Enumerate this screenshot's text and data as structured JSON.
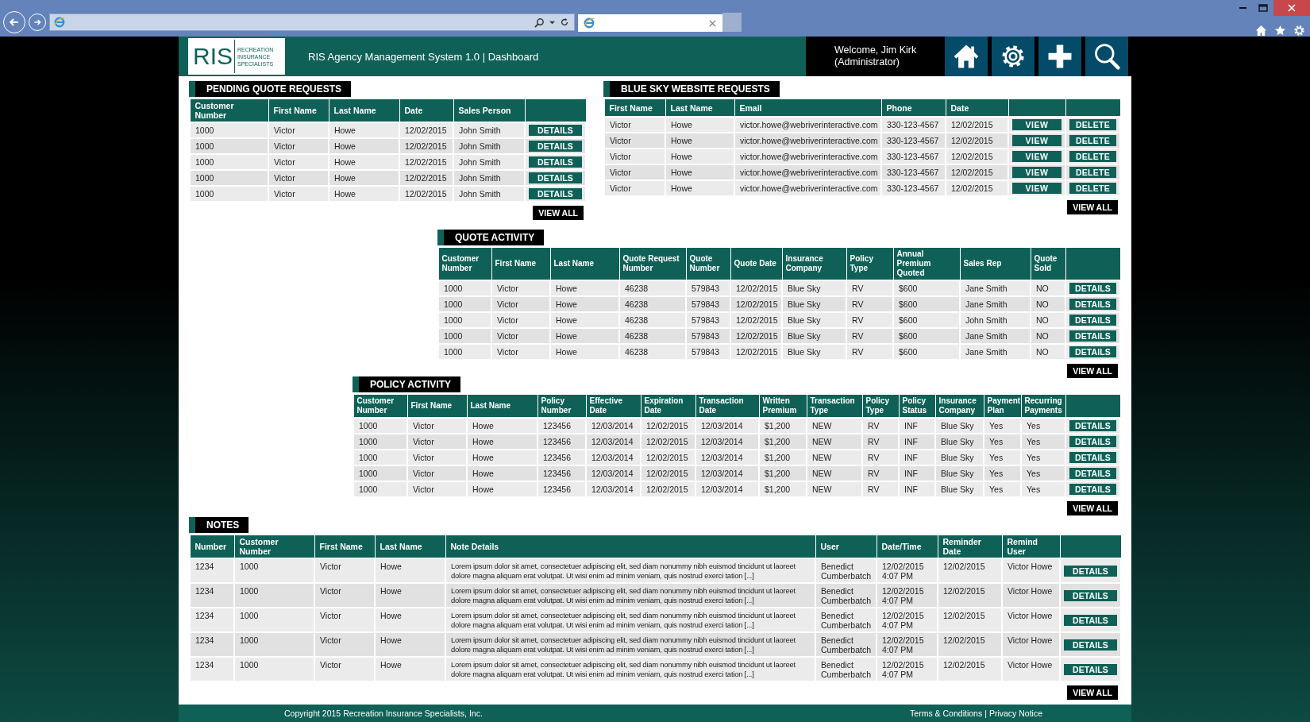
{
  "app": {
    "logo_letters": "RIS",
    "logo_tagline": "RECREATION INSURANCE SPECIALISTS",
    "title": "RIS Agency Management System 1.0 | Dashboard",
    "welcome": "Welcome, Jim Kirk",
    "role": "(Administrator)"
  },
  "sections": [
    {
      "title": "PENDING QUOTE REQUESTS",
      "columns": [
        "Customer Number",
        "First Name",
        "Last Name",
        "Date",
        "Sales Person"
      ],
      "rows": [
        {
          "cells": [
            "1000",
            "Victor",
            "Howe",
            "12/02/2015",
            "John Smith"
          ],
          "actions": [
            {
              "label": "DETAILS",
              "kind": "details"
            }
          ]
        },
        {
          "cells": [
            "1000",
            "Victor",
            "Howe",
            "12/02/2015",
            "John Smith"
          ],
          "actions": [
            {
              "label": "DETAILS",
              "kind": "details"
            }
          ]
        },
        {
          "cells": [
            "1000",
            "Victor",
            "Howe",
            "12/02/2015",
            "John Smith"
          ],
          "actions": [
            {
              "label": "DETAILS",
              "kind": "details"
            }
          ]
        },
        {
          "cells": [
            "1000",
            "Victor",
            "Howe",
            "12/02/2015",
            "John Smith"
          ],
          "actions": [
            {
              "label": "DETAILS",
              "kind": "details"
            }
          ]
        },
        {
          "cells": [
            "1000",
            "Victor",
            "Howe",
            "12/02/2015",
            "John Smith"
          ],
          "actions": [
            {
              "label": "DETAILS",
              "kind": "details"
            }
          ]
        }
      ],
      "view_all": "VIEW ALL"
    },
    {
      "title": "BLUE SKY WEBSITE REQUESTS",
      "columns": [
        "First Name",
        "Last Name",
        "Email",
        "Phone",
        "Date"
      ],
      "rows": [
        {
          "cells": [
            "Victor",
            "Howe",
            "victor.howe@webriverinteractive.com",
            "330-123-4567",
            "12/02/2015"
          ],
          "actions": [
            {
              "label": "VIEW",
              "kind": "view"
            },
            {
              "label": "DELETE",
              "kind": "delete"
            }
          ]
        },
        {
          "cells": [
            "Victor",
            "Howe",
            "victor.howe@webriverinteractive.com",
            "330-123-4567",
            "12/02/2015"
          ],
          "actions": [
            {
              "label": "VIEW",
              "kind": "view"
            },
            {
              "label": "DELETE",
              "kind": "delete"
            }
          ]
        },
        {
          "cells": [
            "Victor",
            "Howe",
            "victor.howe@webriverinteractive.com",
            "330-123-4567",
            "12/02/2015"
          ],
          "actions": [
            {
              "label": "VIEW",
              "kind": "view"
            },
            {
              "label": "DELETE",
              "kind": "delete"
            }
          ]
        },
        {
          "cells": [
            "Victor",
            "Howe",
            "victor.howe@webriverinteractive.com",
            "330-123-4567",
            "12/02/2015"
          ],
          "actions": [
            {
              "label": "VIEW",
              "kind": "view"
            },
            {
              "label": "DELETE",
              "kind": "delete"
            }
          ]
        },
        {
          "cells": [
            "Victor",
            "Howe",
            "victor.howe@webriverinteractive.com",
            "330-123-4567",
            "12/02/2015"
          ],
          "actions": [
            {
              "label": "VIEW",
              "kind": "view"
            },
            {
              "label": "DELETE",
              "kind": "delete"
            }
          ]
        }
      ],
      "view_all": "VIEW ALL"
    },
    {
      "title": "QUOTE ACTIVITY",
      "columns": [
        "Customer Number",
        "First Name",
        "Last Name",
        "Quote Request Number",
        "Quote Number",
        "Quote Date",
        "Insurance Company",
        "Policy Type",
        "Annual Premium Quoted",
        "Sales Rep",
        "Quote Sold"
      ],
      "rows": [
        {
          "cells": [
            "1000",
            "Victor",
            "Howe",
            "46238",
            "579843",
            "12/02/2015",
            "Blue Sky",
            "RV",
            "$600",
            "Jane Smith",
            "NO"
          ],
          "actions": [
            {
              "label": "DETAILS",
              "kind": "details"
            }
          ]
        },
        {
          "cells": [
            "1000",
            "Victor",
            "Howe",
            "46238",
            "579843",
            "12/02/2015",
            "Blue Sky",
            "RV",
            "$600",
            "Jane Smith",
            "NO"
          ],
          "actions": [
            {
              "label": "DETAILS",
              "kind": "details"
            }
          ]
        },
        {
          "cells": [
            "1000",
            "Victor",
            "Howe",
            "46238",
            "579843",
            "12/02/2015",
            "Blue Sky",
            "RV",
            "$600",
            "John Smith",
            "NO"
          ],
          "actions": [
            {
              "label": "DETAILS",
              "kind": "details"
            }
          ]
        },
        {
          "cells": [
            "1000",
            "Victor",
            "Howe",
            "46238",
            "579843",
            "12/02/2015",
            "Blue Sky",
            "RV",
            "$600",
            "Jane Smith",
            "NO"
          ],
          "actions": [
            {
              "label": "DETAILS",
              "kind": "details"
            }
          ]
        },
        {
          "cells": [
            "1000",
            "Victor",
            "Howe",
            "46238",
            "579843",
            "12/02/2015",
            "Blue Sky",
            "RV",
            "$600",
            "Jane Smith",
            "NO"
          ],
          "actions": [
            {
              "label": "DETAILS",
              "kind": "details"
            }
          ]
        }
      ],
      "view_all": "VIEW ALL"
    },
    {
      "title": "POLICY ACTIVITY",
      "columns": [
        "Customer Number",
        "First Name",
        "Last Name",
        "Policy Number",
        "Effective Date",
        "Expiration Date",
        "Transaction Date",
        "Written Premium",
        "Transaction Type",
        "Policy Type",
        "Policy Status",
        "Insurance Company",
        "Payment Plan",
        "Recurring Payments"
      ],
      "rows": [
        {
          "cells": [
            "1000",
            "Victor",
            "Howe",
            "123456",
            "12/03/2014",
            "12/02/2015",
            "12/03/2014",
            "$1,200",
            "NEW",
            "RV",
            "INF",
            "Blue Sky",
            "Yes",
            "Yes"
          ],
          "actions": [
            {
              "label": "DETAILS",
              "kind": "details"
            }
          ]
        },
        {
          "cells": [
            "1000",
            "Victor",
            "Howe",
            "123456",
            "12/03/2014",
            "12/02/2015",
            "12/03/2014",
            "$1,200",
            "NEW",
            "RV",
            "INF",
            "Blue Sky",
            "Yes",
            "Yes"
          ],
          "actions": [
            {
              "label": "DETAILS",
              "kind": "details"
            }
          ]
        },
        {
          "cells": [
            "1000",
            "Victor",
            "Howe",
            "123456",
            "12/03/2014",
            "12/02/2015",
            "12/03/2014",
            "$1,200",
            "NEW",
            "RV",
            "INF",
            "Blue Sky",
            "Yes",
            "Yes"
          ],
          "actions": [
            {
              "label": "DETAILS",
              "kind": "details"
            }
          ]
        },
        {
          "cells": [
            "1000",
            "Victor",
            "Howe",
            "123456",
            "12/03/2014",
            "12/02/2015",
            "12/03/2014",
            "$1,200",
            "NEW",
            "RV",
            "INF",
            "Blue Sky",
            "Yes",
            "Yes"
          ],
          "actions": [
            {
              "label": "DETAILS",
              "kind": "details"
            }
          ]
        },
        {
          "cells": [
            "1000",
            "Victor",
            "Howe",
            "123456",
            "12/03/2014",
            "12/02/2015",
            "12/03/2014",
            "$1,200",
            "NEW",
            "RV",
            "INF",
            "Blue Sky",
            "Yes",
            "Yes"
          ],
          "actions": [
            {
              "label": "DETAILS",
              "kind": "details"
            }
          ]
        }
      ],
      "view_all": "VIEW ALL"
    },
    {
      "title": "NOTES",
      "columns": [
        "Number",
        "Customer Number",
        "First Name",
        "Last Name",
        "Note Details",
        "User",
        "Date/Time",
        "Reminder Date",
        "Remind User"
      ],
      "rows": [
        {
          "cells": [
            "1234",
            "1000",
            "Victor",
            "Howe",
            "Lorem ipsum dolor sit amet, consectetuer adipiscing elit, sed diam nonummy nibh euismod tincidunt ut laoreet dolore magna aliquam erat volutpat. Ut wisi enim ad minim veniam, quis nostrud exerci tation [...]",
            "Benedict Cumberbatch",
            "12/02/2015 4:07 PM",
            "12/02/2015",
            "Victor Howe"
          ],
          "actions": [
            {
              "label": "DETAILS",
              "kind": "details"
            }
          ]
        },
        {
          "cells": [
            "1234",
            "1000",
            "Victor",
            "Howe",
            "Lorem ipsum dolor sit amet, consectetuer adipiscing elit, sed diam nonummy nibh euismod tincidunt ut laoreet dolore magna aliquam erat volutpat. Ut wisi enim ad minim veniam, quis nostrud exerci tation [...]",
            "Benedict Cumberbatch",
            "12/02/2015 4:07 PM",
            "12/02/2015",
            "Victor Howe"
          ],
          "actions": [
            {
              "label": "DETAILS",
              "kind": "details"
            }
          ]
        },
        {
          "cells": [
            "1234",
            "1000",
            "Victor",
            "Howe",
            "Lorem ipsum dolor sit amet, consectetuer adipiscing elit, sed diam nonummy nibh euismod tincidunt ut laoreet dolore magna aliquam erat volutpat. Ut wisi enim ad minim veniam, quis nostrud exerci tation [...]",
            "Benedict Cumberbatch",
            "12/02/2015 4:07 PM",
            "12/02/2015",
            "Victor Howe"
          ],
          "actions": [
            {
              "label": "DETAILS",
              "kind": "details"
            }
          ]
        },
        {
          "cells": [
            "1234",
            "1000",
            "Victor",
            "Howe",
            "Lorem ipsum dolor sit amet, consectetuer adipiscing elit, sed diam nonummy nibh euismod tincidunt ut laoreet dolore magna aliquam erat volutpat. Ut wisi enim ad minim veniam, quis nostrud exerci tation [...]",
            "Benedict Cumberbatch",
            "12/02/2015 4:07 PM",
            "12/02/2015",
            "Victor Howe"
          ],
          "actions": [
            {
              "label": "DETAILS",
              "kind": "details"
            }
          ]
        },
        {
          "cells": [
            "1234",
            "1000",
            "Victor",
            "Howe",
            "Lorem ipsum dolor sit amet, consectetuer adipiscing elit, sed diam nonummy nibh euismod tincidunt ut laoreet dolore magna aliquam erat volutpat. Ut wisi enim ad minim veniam, quis nostrud exerci tation [...]",
            "Benedict Cumberbatch",
            "12/02/2015 4:07 PM",
            "12/02/2015",
            "Victor Howe"
          ],
          "actions": [
            {
              "label": "DETAILS",
              "kind": "details"
            }
          ]
        }
      ],
      "view_all": "VIEW ALL"
    }
  ],
  "footer": {
    "copyright": "Copyright 2015 Recreation Insurance Specialists, Inc.",
    "links": [
      "Terms & Conditions",
      "Privacy Notice"
    ],
    "separator": "|"
  }
}
